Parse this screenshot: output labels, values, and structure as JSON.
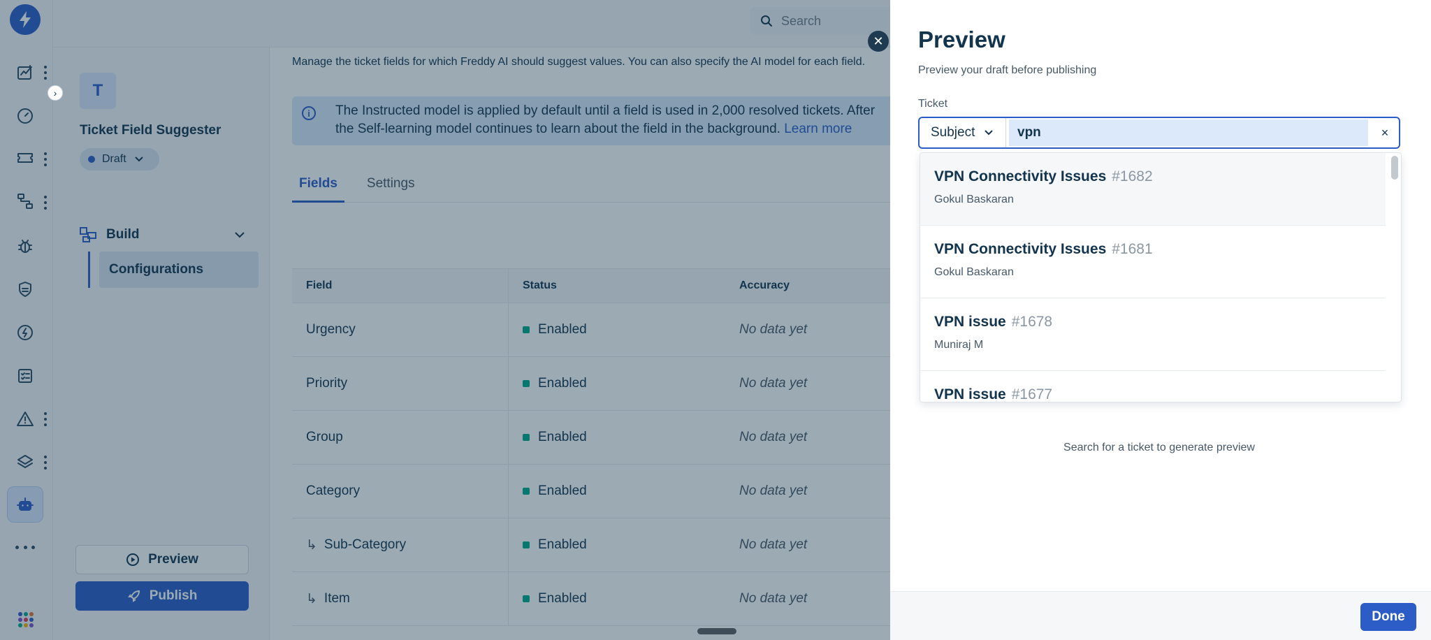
{
  "search": {
    "placeholder": "Search"
  },
  "app": {
    "avatar_letter": "T",
    "title": "Ticket Field Suggester",
    "status": "Draft",
    "build_label": "Build",
    "configurations_label": "Configurations",
    "preview_label": "Preview",
    "publish_label": "Publish"
  },
  "main": {
    "description": "Manage the ticket fields for which Freddy AI should suggest values. You can also specify the AI model for each field.",
    "info_line1": "The Instructed model is applied by default until a field is used in 2,000 resolved tickets. After",
    "info_line2": "the Self-learning model continues to learn about the field in the background.",
    "info_link": "Learn more",
    "tabs": [
      {
        "label": "Fields"
      },
      {
        "label": "Settings"
      }
    ],
    "table": {
      "headers": [
        "Field",
        "Status",
        "Accuracy"
      ],
      "rows": [
        {
          "field": "Urgency",
          "status": "Enabled",
          "accuracy": "No data yet"
        },
        {
          "field": "Priority",
          "status": "Enabled",
          "accuracy": "No data yet"
        },
        {
          "field": "Group",
          "status": "Enabled",
          "accuracy": "No data yet"
        },
        {
          "field": "Category",
          "status": "Enabled",
          "accuracy": "No data yet"
        },
        {
          "field": "Sub-Category",
          "status": "Enabled",
          "accuracy": "No data yet"
        },
        {
          "field": "Item",
          "status": "Enabled",
          "accuracy": "No data yet"
        }
      ]
    }
  },
  "preview": {
    "title": "Preview",
    "subtitle": "Preview your draft before publishing",
    "ticket_label": "Ticket",
    "search_by": "Subject",
    "query": "vpn",
    "clear": "×",
    "results": [
      {
        "title": "VPN Connectivity Issues",
        "id": "#1682",
        "requester": "Gokul Baskaran"
      },
      {
        "title": "VPN Connectivity Issues",
        "id": "#1681",
        "requester": "Gokul Baskaran"
      },
      {
        "title": "VPN issue",
        "id": "#1678",
        "requester": "Muniraj M"
      },
      {
        "title": "VPN issue",
        "id": "#1677",
        "requester": ""
      }
    ],
    "empty_message": "Search for a ticket to generate preview",
    "done_label": "Done"
  },
  "icons": [
    "bolt-logo",
    "analytics-icon",
    "dashboard-icon",
    "ticket-icon",
    "workflow-icon",
    "bug-icon",
    "shield-icon",
    "billing-icon",
    "checklist-icon",
    "alert-icon",
    "layers-icon",
    "bot-icon",
    "more-icon",
    "apps-icon"
  ],
  "colors": {
    "brand": "#2c5cc5",
    "enabled": "#00a886",
    "overlay": "rgba(18,52,77,0.42)"
  }
}
